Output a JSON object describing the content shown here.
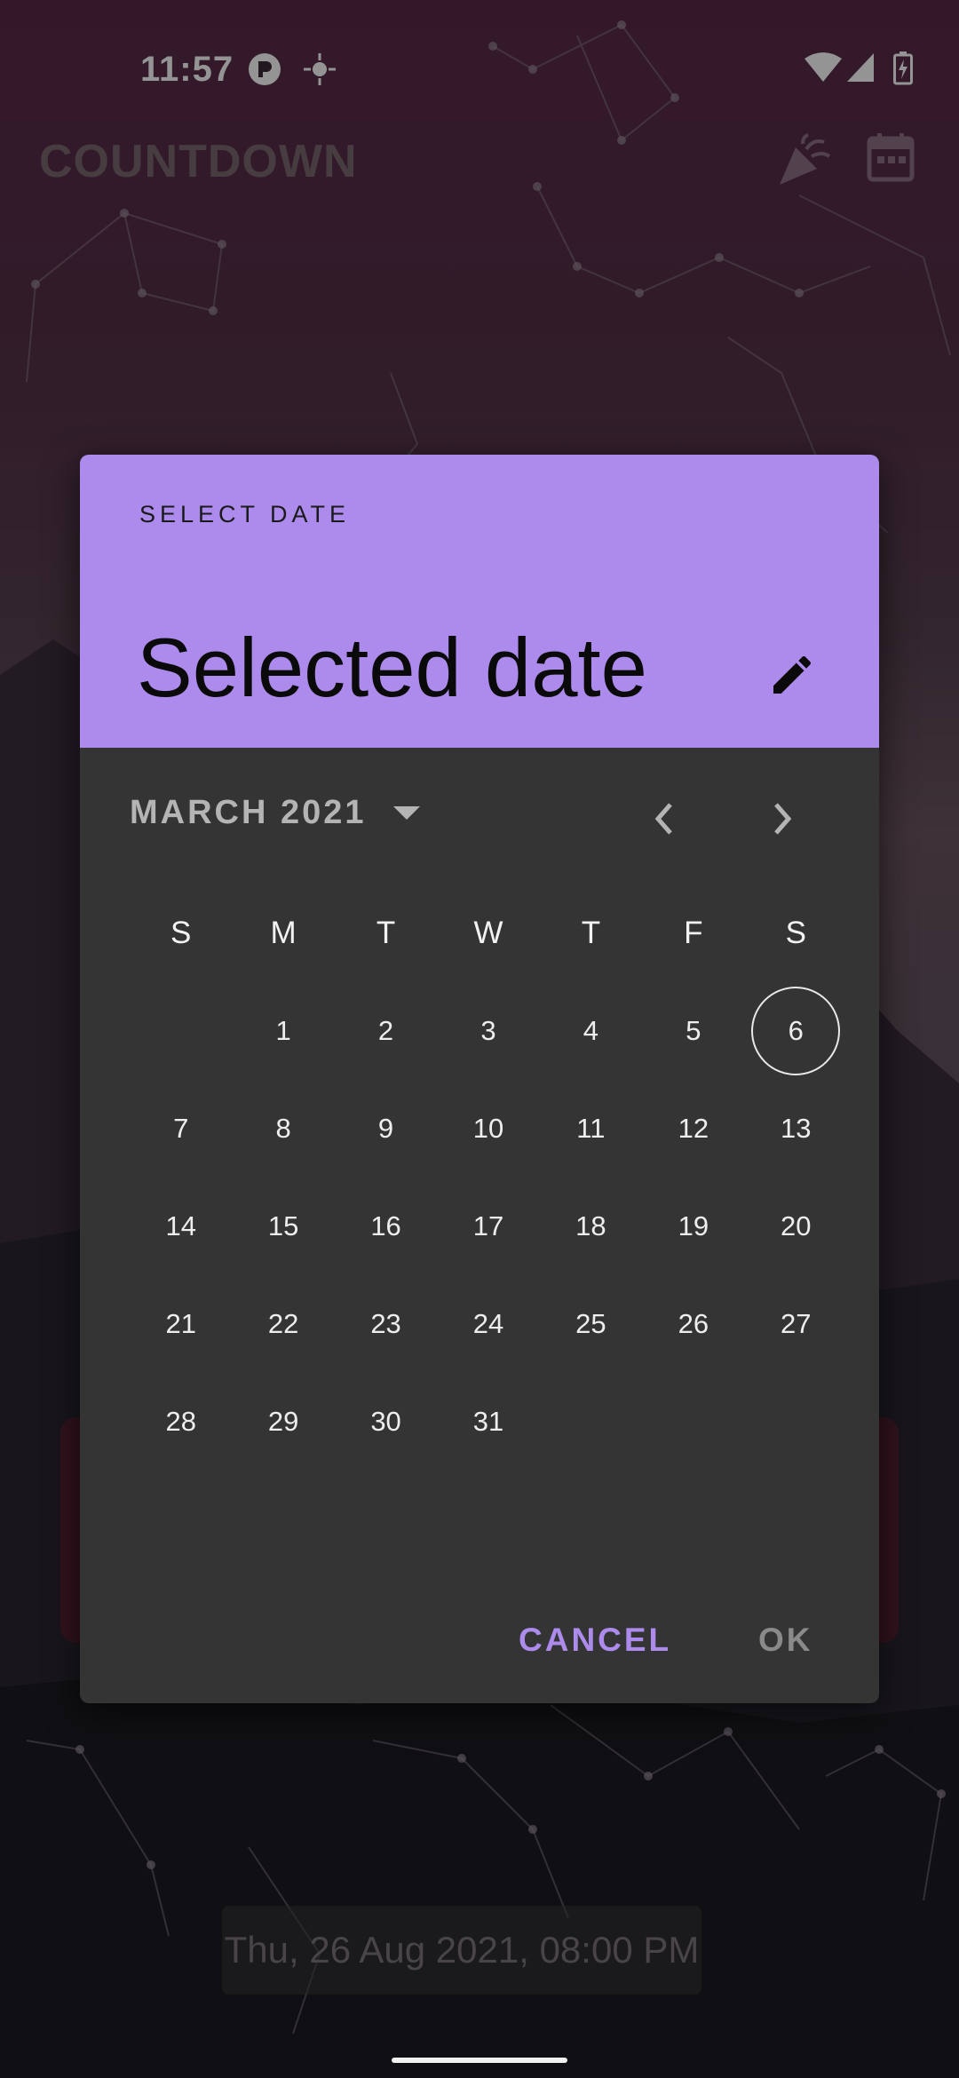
{
  "status_bar": {
    "time": "11:57"
  },
  "app_bar": {
    "title": "COUNTDOWN"
  },
  "background": {
    "date_text": "Thu, 26 Aug 2021, 08:00 PM"
  },
  "dialog": {
    "label": "SELECT DATE",
    "headline": "Selected date",
    "month_label": "MARCH 2021",
    "weekday_headers": [
      "S",
      "M",
      "T",
      "W",
      "T",
      "F",
      "S"
    ],
    "weeks": [
      [
        "",
        "1",
        "2",
        "3",
        "4",
        "5",
        "6"
      ],
      [
        "7",
        "8",
        "9",
        "10",
        "11",
        "12",
        "13"
      ],
      [
        "14",
        "15",
        "16",
        "17",
        "18",
        "19",
        "20"
      ],
      [
        "21",
        "22",
        "23",
        "24",
        "25",
        "26",
        "27"
      ],
      [
        "28",
        "29",
        "30",
        "31",
        "",
        "",
        ""
      ]
    ],
    "today": "6",
    "cancel_label": "CANCEL",
    "ok_label": "OK"
  },
  "colors": {
    "header_bg": "#ac8bec",
    "dialog_bg": "#343434",
    "accent": "#ac8bec"
  },
  "icons": {
    "edit": "pencil-icon",
    "month_dropdown": "caret-down-icon",
    "prev": "chevron-left-icon",
    "next": "chevron-right-icon"
  }
}
